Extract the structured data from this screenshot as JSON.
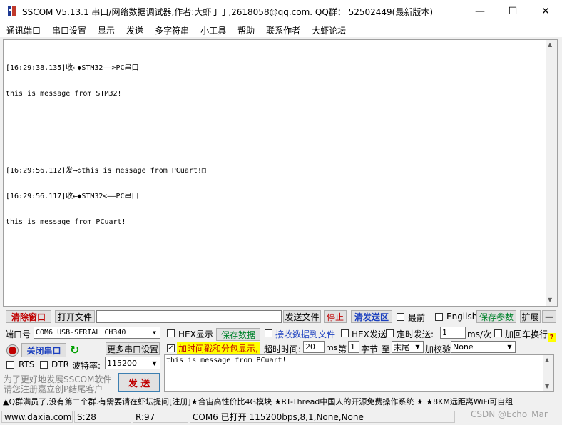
{
  "window": {
    "title": "SSCOM V5.13.1 串口/网络数据调试器,作者:大虾丁丁,2618058@qq.com. QQ群：  52502449(最新版本)",
    "minimize_glyph": "—",
    "maximize_glyph": "☐",
    "close_glyph": "✕"
  },
  "menu": [
    "通讯端口",
    "串口设置",
    "显示",
    "发送",
    "多字符串",
    "小工具",
    "帮助",
    "联系作者",
    "大虾论坛"
  ],
  "receive": {
    "lines": [
      "[16:29:38.135]收←◆STM32——>PC串口",
      "this is message from STM32!",
      "",
      "",
      "[16:29:56.112]发→◇this is message from PCuart!□",
      "[16:29:56.117]收←◆STM32<——PC串口",
      "this is message from PCuart!"
    ]
  },
  "toolbar": {
    "clear_window": "清除窗口",
    "open_file": "打开文件",
    "file_path": "",
    "send_file": "发送文件",
    "stop": "停止",
    "clear_send_area": "清发送区",
    "topmost": "最前",
    "english": "English",
    "save_params": "保存参数",
    "expand": "扩展",
    "collapse": "—"
  },
  "port": {
    "label": "端口号",
    "value": "COM6 USB-SERIAL CH340",
    "close_port": "关闭串口",
    "more_settings": "更多串口设置",
    "rts": "RTS",
    "dtr": "DTR",
    "baud_label": "波特率:",
    "baud_value": "115200",
    "promo_line1": "为了更好地发展SSCOM软件",
    "promo_line2": "请您注册嘉立创P结尾客户",
    "send": "发 送"
  },
  "options": {
    "hex_display": "HEX显示",
    "save_data": "保存数据",
    "recv_to_file": "接收数据到文件",
    "hex_send": "HEX发送",
    "timed_send": "定时发送:",
    "timed_value": "1",
    "timed_unit": "ms/次",
    "add_crlf": "加回车换行",
    "timestamp_packet": "加时间戳和分包显示,",
    "timeout_label": "超时时间:",
    "timeout_value": "20",
    "timeout_unit": "ms",
    "nth_label": "第",
    "byte_index": "1",
    "byte_label": "字节",
    "to_label": "至",
    "end_value": "末尾",
    "checksum_label": "加校验",
    "checksum_value": "None"
  },
  "send_text": "this is message from PCuart!",
  "ticker": "▲Q群满员了,没有第二个群.有需要请在虾坛提问[注册]★合宙高性价比4G模块 ★RT-Thread中国人的开源免费操作系统 ★ ★8KM远距离WiFi可自组",
  "status": {
    "site": "www.daxia.com",
    "sent": "S:28",
    "received": "R:97",
    "port_state": "COM6 已打开  115200bps,8,1,None,None",
    "watermark": "CSDN @Echo_Mar"
  },
  "colors": {
    "accent_red": "#c00000",
    "accent_green": "#00832c",
    "accent_blue": "#1a3fbf",
    "highlight_yellow": "#ffff00"
  }
}
